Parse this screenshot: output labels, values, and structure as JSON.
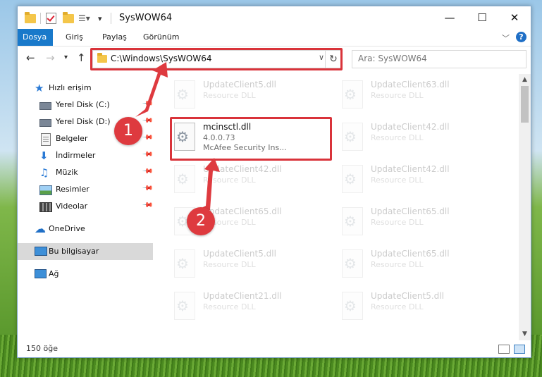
{
  "window": {
    "title": "SysWOW64"
  },
  "ribbon": {
    "tabs": [
      "Dosya",
      "Giriş",
      "Paylaş",
      "Görünüm"
    ]
  },
  "navbar": {
    "address": "C:\\Windows\\SysWOW64",
    "search_placeholder": "Ara: SysWOW64"
  },
  "sidebar": {
    "quick_access": "Hızlı erişim",
    "items": [
      "Yerel Disk (C:)",
      "Yerel Disk (D:)",
      "Belgeler",
      "İndirmeler",
      "Müzik",
      "Resimler",
      "Videolar"
    ],
    "onedrive": "OneDrive",
    "this_pc": "Bu bilgisayar",
    "network": "Ağ"
  },
  "files": {
    "highlighted": {
      "name": "mcinsctl.dll",
      "version": "4.0.0.73",
      "company": "McAfee Security Ins..."
    },
    "faded": [
      {
        "name": "UpdateClient5.dll",
        "desc": "Resource DLL"
      },
      {
        "name": "UpdateClient63.dll",
        "desc": "Resource DLL"
      },
      {
        "name": "UpdateClient42.dll",
        "desc": "Resource DLL"
      },
      {
        "name": "UpdateClient42.dll",
        "desc": "Resource DLL"
      },
      {
        "name": "UpdateClient42.dll",
        "desc": "Resource DLL"
      },
      {
        "name": "UpdateClient65.dll",
        "desc": "Resource DLL"
      },
      {
        "name": "UpdateClient65.dll",
        "desc": "Resource DLL"
      },
      {
        "name": "UpdateClient5.dll",
        "desc": "Resource DLL"
      },
      {
        "name": "UpdateClient65.dll",
        "desc": "Resource DLL"
      },
      {
        "name": "UpdateClient21.dll",
        "desc": "Resource DLL"
      },
      {
        "name": "UpdateClient5.dll",
        "desc": "Resource DLL"
      }
    ]
  },
  "status": {
    "count": "150 öğe"
  },
  "annotations": {
    "step1": "1",
    "step2": "2",
    "color": "#de3a3f"
  }
}
